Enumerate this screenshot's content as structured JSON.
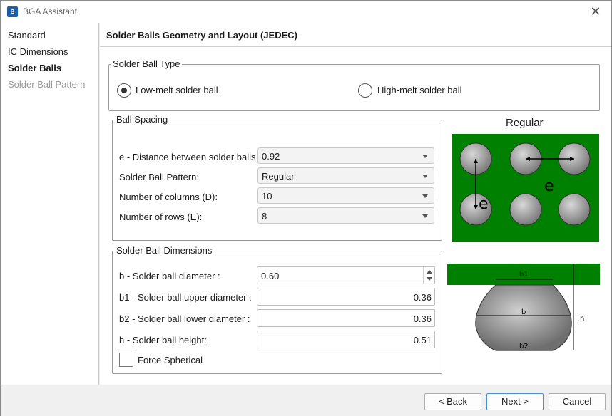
{
  "window": {
    "title": "BGA Assistant",
    "icon": "app-icon"
  },
  "sidebar": {
    "items": [
      {
        "label": "Standard",
        "state": "normal"
      },
      {
        "label": "IC Dimensions",
        "state": "normal"
      },
      {
        "label": "Solder Balls",
        "state": "active"
      },
      {
        "label": "Solder Ball Pattern",
        "state": "disabled"
      }
    ]
  },
  "main": {
    "title": "Solder Balls Geometry and Layout (JEDEC)",
    "ball_type": {
      "group_label": "Solder Ball Type",
      "options": [
        {
          "label": "Low-melt solder ball",
          "selected": true
        },
        {
          "label": "High-melt solder ball",
          "selected": false
        }
      ]
    },
    "ball_spacing": {
      "group_label": "Ball Spacing",
      "fields": [
        {
          "label": "e - Distance between solder balls",
          "value": "0.92"
        },
        {
          "label": "Solder Ball Pattern:",
          "value": "Regular"
        },
        {
          "label": "Number of columns (D):",
          "value": "10"
        },
        {
          "label": "Number of rows (E):",
          "value": "8"
        }
      ]
    },
    "ball_dimensions": {
      "group_label": "Solder Ball Dimensions",
      "fields": [
        {
          "label": "b - Solder ball diameter :",
          "value": "0.60"
        },
        {
          "label": "b1 - Solder ball upper diameter :",
          "value": "0.36"
        },
        {
          "label": "b2 - Solder ball lower diameter :",
          "value": "0.36"
        },
        {
          "label": "h - Solder ball height:",
          "value": "0.51"
        }
      ],
      "force_spherical": {
        "label": "Force Spherical",
        "checked": false
      }
    },
    "diagram": {
      "title": "Regular",
      "spacing_label": "e",
      "labels": {
        "b1": "b1",
        "b": "b",
        "b2": "b2",
        "h": "h"
      },
      "board_color": "#008000",
      "ball_color": "#9a9a9a"
    }
  },
  "footer": {
    "back_label": "< Back",
    "next_label": "Next >",
    "cancel_label": "Cancel"
  }
}
